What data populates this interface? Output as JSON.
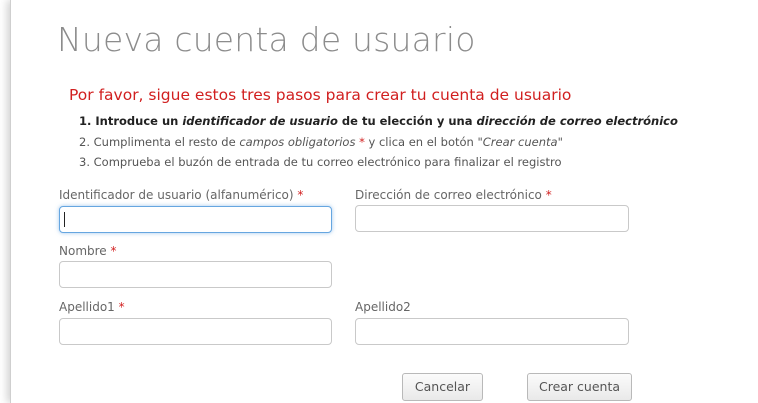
{
  "title": "Nueva cuenta de usuario",
  "instructions": {
    "heading": "Por favor, sigue estos tres pasos para crear tu cuenta de usuario",
    "step1": {
      "a": "1. Introduce un ",
      "b": "identificador de usuario",
      "c": " de tu elección y una ",
      "d": "dirección de correo electrónico"
    },
    "step2": {
      "a": "2. Cumplimenta el resto de ",
      "b": "campos obligatorios",
      "req": " *",
      "c": " y clica en el botón \"",
      "d": "Crear cuenta",
      "e": "\""
    },
    "step3": "3. Comprueba el buzón de entrada de tu correo electrónico para finalizar el registro"
  },
  "form": {
    "required_marker": "*",
    "username": {
      "label": "Identificador de usuario (alfanumérico)",
      "value": "",
      "required": true
    },
    "email": {
      "label": "Dirección de correo electrónico",
      "value": "",
      "required": true
    },
    "name": {
      "label": "Nombre",
      "value": "",
      "required": true
    },
    "surname1": {
      "label": "Apellido1",
      "value": "",
      "required": true
    },
    "surname2": {
      "label": "Apellido2",
      "value": "",
      "required": false
    }
  },
  "buttons": {
    "cancel": "Cancelar",
    "create": "Crear cuenta"
  },
  "colors": {
    "required": "#d11f1f",
    "heading": "#d11f1f",
    "focus": "#66a6e0"
  }
}
